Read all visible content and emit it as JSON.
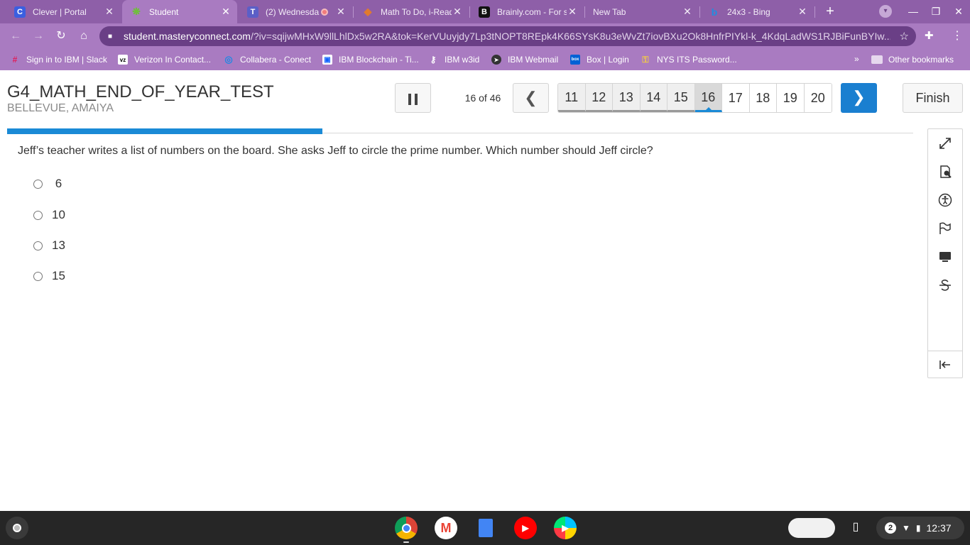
{
  "browser": {
    "tabs": [
      {
        "title": "Clever | Portal",
        "favicon": "C",
        "color": "#3b5fe0"
      },
      {
        "title": "Student",
        "favicon": "❋",
        "color": "#6fbf3c"
      },
      {
        "title": "(2) Wednesda",
        "favicon": "T",
        "color": "#5b5fc7"
      },
      {
        "title": "Math To Do, i-Read",
        "favicon": "◆",
        "color": "#e07a2e"
      },
      {
        "title": "Brainly.com - For s",
        "favicon": "B",
        "color": "#111111"
      },
      {
        "title": "New Tab",
        "favicon": "",
        "color": ""
      },
      {
        "title": "24x3 - Bing",
        "favicon": "b",
        "color": "#1f8de0"
      }
    ],
    "url_host": "student.masteryconnect.com",
    "url_rest": "/?iv=sqijwMHxW9llLhlDx5w2RA&tok=KerVUuyjdy7Lp3tNOPT8REpk4K66SYsK8u3eWvZt7iovBXu2Ok8HnfrPIYkl-k_4KdqLadWS1RJBiFunBYIw...",
    "bookmarks": [
      {
        "label": "Sign in to IBM | Slack",
        "icon": "#",
        "color": "#e01e5a"
      },
      {
        "label": "Verizon In Contact...",
        "icon": "vz",
        "color": "#000000"
      },
      {
        "label": "Collabera - Conect",
        "icon": "◎",
        "color": "#1e88e5"
      },
      {
        "label": "IBM Blockchain - Ti...",
        "icon": "▣",
        "color": "#0f62fe"
      },
      {
        "label": "IBM w3id",
        "icon": "⚷",
        "color": "#555555"
      },
      {
        "label": "IBM Webmail",
        "icon": "➤",
        "color": "#333333"
      },
      {
        "label": "Box | Login",
        "icon": "box",
        "color": "#0061d5"
      },
      {
        "label": "NYS ITS Password...",
        "icon": "⚿",
        "color": "#c8a32a"
      }
    ],
    "more_bookmarks": "»",
    "other_bookmarks": "Other bookmarks"
  },
  "test": {
    "title": "G4_MATH_END_OF_YEAR_TEST",
    "student": "BELLEVUE, AMAIYA",
    "counter": "16 of 46",
    "progress_fraction": 0.348,
    "question_numbers": [
      "11",
      "12",
      "13",
      "14",
      "15",
      "16",
      "17",
      "18",
      "19",
      "20"
    ],
    "current_question": "16",
    "finish_label": "Finish",
    "question_text": "Jeff’s teacher writes a list of numbers on the board.  She asks Jeff to circle the prime number.  Which number should Jeff circle?",
    "answers": [
      " 6",
      "10",
      "13",
      "15"
    ]
  },
  "shelf": {
    "time": "12:37",
    "notification_count": "2"
  },
  "colors": {
    "brand_blue": "#1a8ad6",
    "browser_purple": "#a97bc1"
  }
}
